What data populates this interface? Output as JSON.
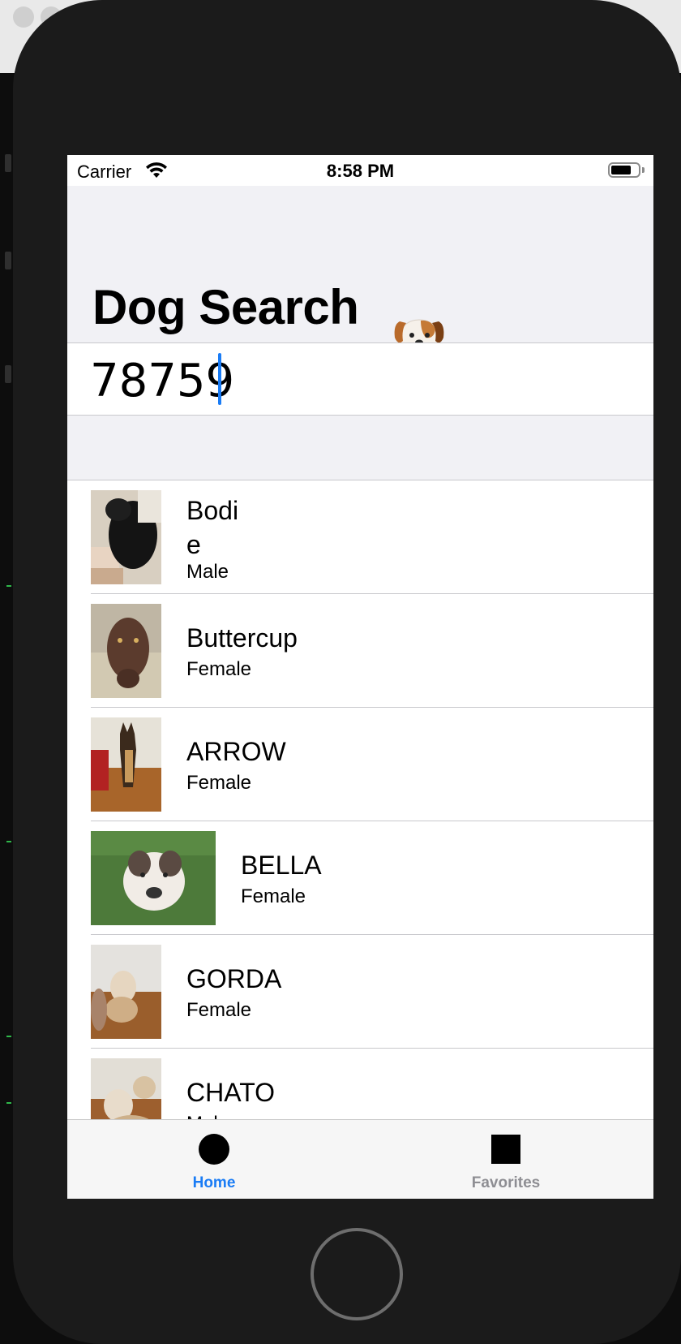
{
  "status_bar": {
    "carrier": "Carrier",
    "time": "8:58 PM"
  },
  "nav": {
    "title": "Dog Search"
  },
  "search": {
    "value": "78759",
    "placeholder": ""
  },
  "dogs": [
    {
      "name": "Bodi\ne",
      "gender": "Male"
    },
    {
      "name": "Buttercup",
      "gender": "Female"
    },
    {
      "name": "ARROW",
      "gender": "Female"
    },
    {
      "name": "BELLA",
      "gender": "Female"
    },
    {
      "name": "GORDA",
      "gender": "Female"
    },
    {
      "name": "CHATO",
      "gender": "Male"
    }
  ],
  "tabs": [
    {
      "label": "Home",
      "icon": "circle-icon",
      "selected": true
    },
    {
      "label": "Favorites",
      "icon": "square-icon",
      "selected": false
    }
  ],
  "colors": {
    "accent": "#1a7cf5",
    "tab_inactive": "#8e8e93",
    "background": "#f1f1f5"
  }
}
